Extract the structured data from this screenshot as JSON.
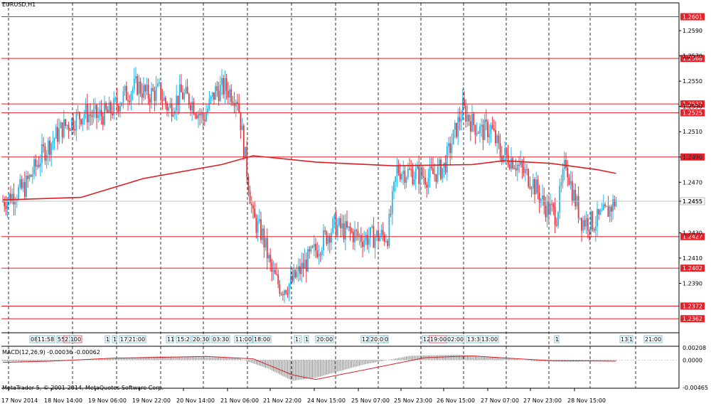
{
  "chart_title": "EURUSD,H1",
  "indicator_label": "MACD(12,26,9) -0.00036 -0.00062",
  "copyright": "MetaTrader 5, © 2001-2014, MetaQuotes Software Corp.",
  "colors": {
    "up": "#21b5ea",
    "down": "#e8333c",
    "level": "#e8202a",
    "ma": "#d92027",
    "grid": "#000000"
  },
  "price_scale": {
    "min": 1.2352,
    "max": 1.2612
  },
  "y_ticks": [
    "1.2590",
    "1.2570",
    "1.2550",
    "1.2530",
    "1.2510",
    "1.2490",
    "1.2470",
    "1.2455",
    "1.2430",
    "1.2410",
    "1.2390"
  ],
  "levels": [
    {
      "label": "1.2601",
      "price": 1.2601
    },
    {
      "label": "1.2568",
      "price": 1.2568
    },
    {
      "label": "1.2532",
      "price": 1.2532
    },
    {
      "label": "1.2525",
      "price": 1.2525
    },
    {
      "label": "1.2490",
      "price": 1.249
    },
    {
      "label": "1.2427",
      "price": 1.2427
    },
    {
      "label": "1.2402",
      "price": 1.2402
    },
    {
      "label": "1.2372",
      "price": 1.2372
    },
    {
      "label": "1.2362",
      "price": 1.2362
    }
  ],
  "current_price": "1.2455",
  "macd_ticks": [
    "0.00208",
    "0.0000",
    "-0.00465"
  ],
  "time_labels": [
    "17 Nov 2014",
    "18 Nov 14:00",
    "19 Nov 06:00",
    "19 Nov 22:00",
    "20 Nov 14:00",
    "21 Nov 06:00",
    "21 Nov 22:00",
    "24 Nov 15:00",
    "25 Nov 07:00",
    "25 Nov 23:00",
    "26 Nov 15:00",
    "27 Nov 07:00",
    "27 Nov 23:00",
    "28 Nov 15:00"
  ],
  "events": [
    "08",
    "11:58",
    "55",
    "23:00",
    "1",
    "1",
    "1",
    "17:",
    "21:00",
    "11",
    "15:2",
    "20:30",
    "03:30",
    "11:00",
    "18:00",
    "1:",
    "1",
    "20:00",
    "12",
    "20:00",
    "0",
    "12:45",
    "19:00",
    "02:00",
    "13:30",
    "13:00",
    "1",
    "13:",
    "1",
    "21:00"
  ],
  "chart_data": {
    "type": "candlestick",
    "timeframe": "H1",
    "symbol": "EURUSD",
    "path": [
      [
        0,
        1.2455
      ],
      [
        14,
        1.2466
      ],
      [
        26,
        1.2494
      ],
      [
        38,
        1.2513
      ],
      [
        52,
        1.2525
      ],
      [
        60,
        1.2522
      ],
      [
        68,
        1.2525
      ],
      [
        78,
        1.2539
      ],
      [
        86,
        1.2547
      ],
      [
        92,
        1.2539
      ],
      [
        100,
        1.2542
      ],
      [
        106,
        1.2528
      ],
      [
        114,
        1.254
      ],
      [
        120,
        1.2535
      ],
      [
        128,
        1.252
      ],
      [
        136,
        1.2542
      ],
      [
        142,
        1.2545
      ],
      [
        150,
        1.2537
      ],
      [
        160,
        1.2441
      ],
      [
        166,
        1.2428
      ],
      [
        172,
        1.2398
      ],
      [
        178,
        1.2386
      ],
      [
        184,
        1.239
      ],
      [
        196,
        1.241
      ],
      [
        212,
        1.2436
      ],
      [
        218,
        1.2432
      ],
      [
        230,
        1.2426
      ],
      [
        246,
        1.2428
      ],
      [
        252,
        1.248
      ],
      [
        262,
        1.2477
      ],
      [
        272,
        1.2474
      ],
      [
        282,
        1.2482
      ],
      [
        290,
        1.2513
      ],
      [
        294,
        1.2528
      ],
      [
        300,
        1.2517
      ],
      [
        306,
        1.251
      ],
      [
        312,
        1.2513
      ],
      [
        318,
        1.2493
      ],
      [
        326,
        1.2488
      ],
      [
        332,
        1.2479
      ],
      [
        338,
        1.2472
      ],
      [
        346,
        1.2452
      ],
      [
        354,
        1.2444
      ],
      [
        360,
        1.2487
      ],
      [
        364,
        1.2463
      ],
      [
        370,
        1.244
      ],
      [
        378,
        1.2438
      ],
      [
        386,
        1.2446
      ],
      [
        392,
        1.2456
      ]
    ],
    "ma_path": [
      [
        0,
        1.2456
      ],
      [
        50,
        1.2458
      ],
      [
        90,
        1.2473
      ],
      [
        140,
        1.2484
      ],
      [
        160,
        1.2491
      ],
      [
        200,
        1.2486
      ],
      [
        250,
        1.2483
      ],
      [
        300,
        1.2484
      ],
      [
        320,
        1.2487
      ],
      [
        350,
        1.2485
      ],
      [
        380,
        1.248
      ],
      [
        392,
        1.2477
      ]
    ],
    "macd_path": [
      [
        0,
        -0.0002
      ],
      [
        20,
        -0.0003
      ],
      [
        50,
        0.0001
      ],
      [
        100,
        0.0006
      ],
      [
        150,
        0.0004
      ],
      [
        170,
        -0.0015
      ],
      [
        185,
        -0.0035
      ],
      [
        200,
        -0.003
      ],
      [
        230,
        -0.0008
      ],
      [
        260,
        0.0007
      ],
      [
        290,
        0.0009
      ],
      [
        320,
        0.0004
      ],
      [
        340,
        -0.0002
      ],
      [
        360,
        -0.0003
      ],
      [
        392,
        -0.0001
      ]
    ],
    "signal_path": [
      [
        0,
        -0.0004
      ],
      [
        30,
        -0.0002
      ],
      [
        70,
        0.0003
      ],
      [
        130,
        0.0006
      ],
      [
        160,
        0.0002
      ],
      [
        185,
        -0.0025
      ],
      [
        200,
        -0.0033
      ],
      [
        240,
        -0.0012
      ],
      [
        270,
        0.0004
      ],
      [
        300,
        0.0007
      ],
      [
        330,
        0.0002
      ],
      [
        350,
        -0.0001
      ],
      [
        392,
        -0.0002
      ]
    ]
  }
}
